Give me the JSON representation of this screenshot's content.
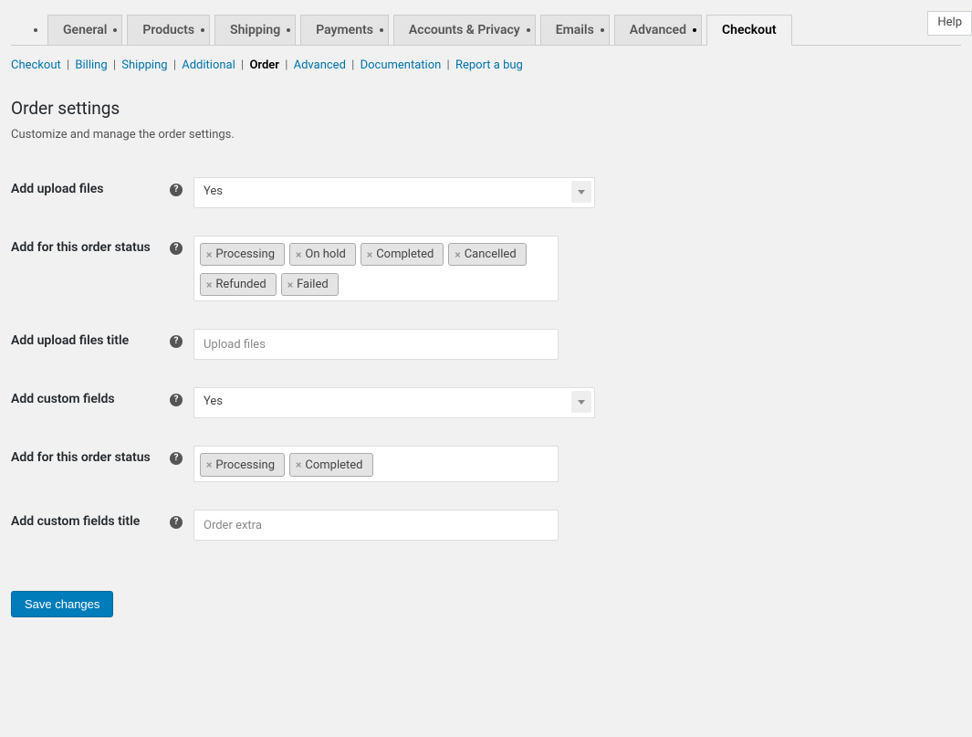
{
  "helpButton": "Help",
  "tabs": [
    {
      "label": "General",
      "active": false
    },
    {
      "label": "Products",
      "active": false
    },
    {
      "label": "Shipping",
      "active": false
    },
    {
      "label": "Payments",
      "active": false
    },
    {
      "label": "Accounts & Privacy",
      "active": false
    },
    {
      "label": "Emails",
      "active": false
    },
    {
      "label": "Advanced",
      "active": false
    },
    {
      "label": "Checkout",
      "active": true
    }
  ],
  "subsubsub": [
    {
      "label": "Checkout",
      "current": false
    },
    {
      "label": "Billing",
      "current": false
    },
    {
      "label": "Shipping",
      "current": false
    },
    {
      "label": "Additional",
      "current": false
    },
    {
      "label": "Order",
      "current": true
    },
    {
      "label": "Advanced",
      "current": false
    },
    {
      "label": "Documentation",
      "current": false
    },
    {
      "label": "Report a bug",
      "current": false
    }
  ],
  "page": {
    "title": "Order settings",
    "description": "Customize and manage the order settings."
  },
  "fields": {
    "addUploadFiles": {
      "label": "Add upload files",
      "value": "Yes"
    },
    "addForOrderStatus1": {
      "label": "Add for this order status",
      "tags": [
        "Processing",
        "On hold",
        "Completed",
        "Cancelled",
        "Refunded",
        "Failed"
      ]
    },
    "addUploadFilesTitle": {
      "label": "Add upload files title",
      "placeholder": "Upload files",
      "value": ""
    },
    "addCustomFields": {
      "label": "Add custom fields",
      "value": "Yes"
    },
    "addForOrderStatus2": {
      "label": "Add for this order status",
      "tags": [
        "Processing",
        "Completed"
      ]
    },
    "addCustomFieldsTitle": {
      "label": "Add custom fields title",
      "placeholder": "Order extra",
      "value": ""
    }
  },
  "saveButton": "Save changes"
}
